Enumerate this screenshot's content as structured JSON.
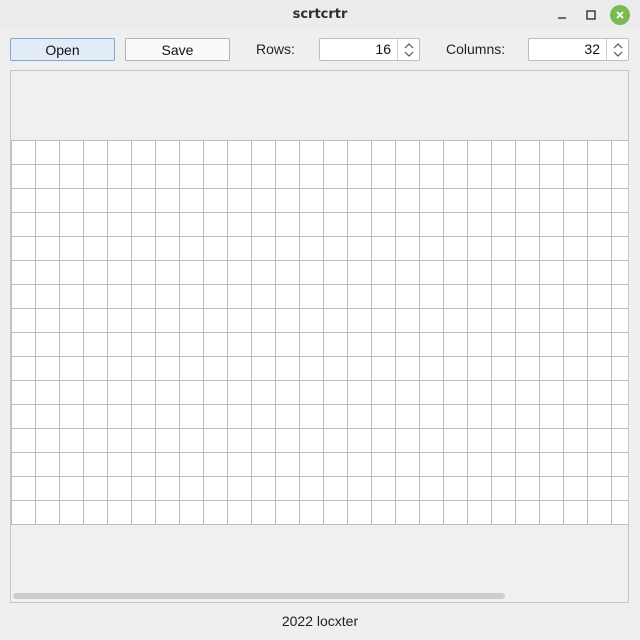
{
  "window": {
    "title": "scrtcrtr",
    "close_color": "#7cba52"
  },
  "toolbar": {
    "open_label": "Open",
    "save_label": "Save",
    "rows_label": "Rows:",
    "rows_value": "16",
    "columns_label": "Columns:",
    "columns_value": "32"
  },
  "grid": {
    "rows": 16,
    "columns": 32,
    "cell_fill": "#ffffff",
    "line_color": "#bdbdbd"
  },
  "icons": {
    "minimize": "minimize-icon",
    "maximize": "maximize-icon",
    "close": "close-icon",
    "spin": "spin-arrows-icon"
  },
  "footer": {
    "text": "2022 locxter"
  }
}
